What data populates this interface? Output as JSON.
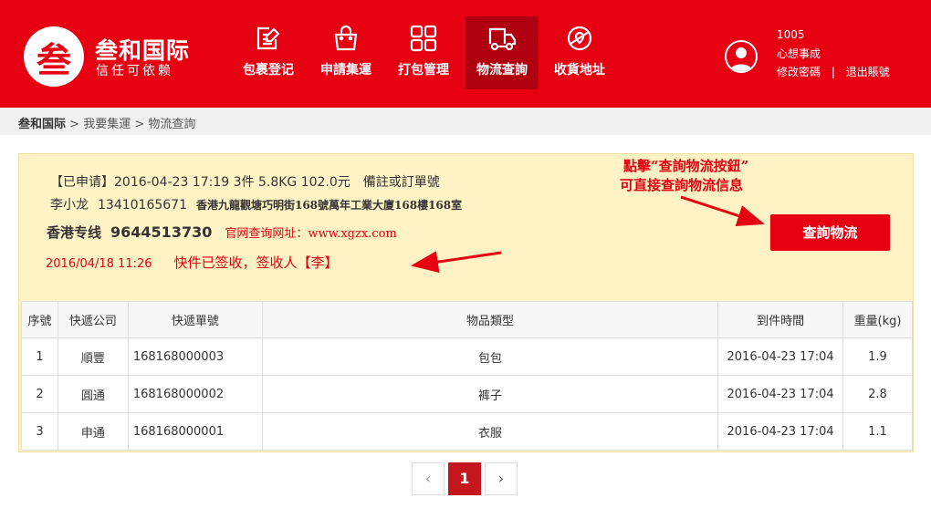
{
  "brand": {
    "logo_char": "叁",
    "name": "叁和国际",
    "slogan": "信任可依赖"
  },
  "nav": {
    "items": [
      {
        "label": "包裹登记",
        "icon": "edit-icon"
      },
      {
        "label": "申請集運",
        "icon": "bag-icon"
      },
      {
        "label": "打包管理",
        "icon": "grid-icon"
      },
      {
        "label": "物流查詢",
        "icon": "truck-icon",
        "active": true
      },
      {
        "label": "收貨地址",
        "icon": "map-pin-icon"
      }
    ]
  },
  "user": {
    "id": "1005",
    "name": "心想事成",
    "change_password": "修改密碼",
    "separator": "|",
    "logout": "退出賬號"
  },
  "breadcrumb": {
    "root": "叁和国际",
    "sep1": " > ",
    "level1": "我要集運",
    "sep2": " > ",
    "current": "物流查詢"
  },
  "order": {
    "summary": "【已申请】2016-04-23 17:19 3件 5.8KG 102.0元",
    "remark": "備註或訂單號",
    "recipient": "李小龙",
    "phone": "13410165671",
    "address": "香港九龍觀塘巧明街168號萬年工業大廈168樓168室",
    "carrier": "香港专线",
    "tracking_no": "9644513730",
    "site": "官网查询网址：www.xgzx.com",
    "status_time": "2016/04/18 11:26",
    "status_msg": "快件已签收，签收人【李】"
  },
  "annotation": {
    "line1": "點擊“查詢物流按鈕”",
    "line2": "可直接查詢物流信息"
  },
  "query_button": "查詢物流",
  "table": {
    "headers": [
      "序號",
      "快遞公司",
      "快遞單號",
      "物品類型",
      "到件時間",
      "重量(kg)"
    ],
    "rows": [
      [
        "1",
        "順豐",
        "168168000003",
        "包包",
        "2016-04-23 17:04",
        "1.9"
      ],
      [
        "2",
        "圓通",
        "168168000002",
        "裤子",
        "2016-04-23 17:04",
        "2.8"
      ],
      [
        "3",
        "申通",
        "168168000001",
        "衣服",
        "2016-04-23 17:04",
        "1.1"
      ]
    ]
  },
  "pager": {
    "prev": "‹",
    "current": "1",
    "next": "›"
  },
  "colors": {
    "brand_red": "#e60012",
    "panel_bg": "#fff3c6"
  }
}
